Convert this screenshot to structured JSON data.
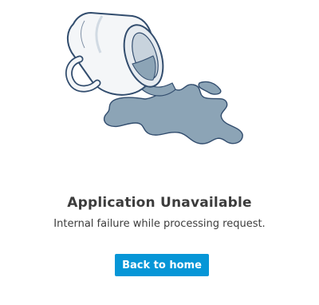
{
  "error": {
    "illustration_icon": "spilled-mug-icon",
    "title": "Application Unavailable",
    "message": "Internal failure while processing request.",
    "button_label": "Back to home"
  },
  "colors": {
    "accent": "#0696d7",
    "text": "#3c3c3c",
    "spill": "#8ca4b6",
    "outline": "#324d6e"
  }
}
